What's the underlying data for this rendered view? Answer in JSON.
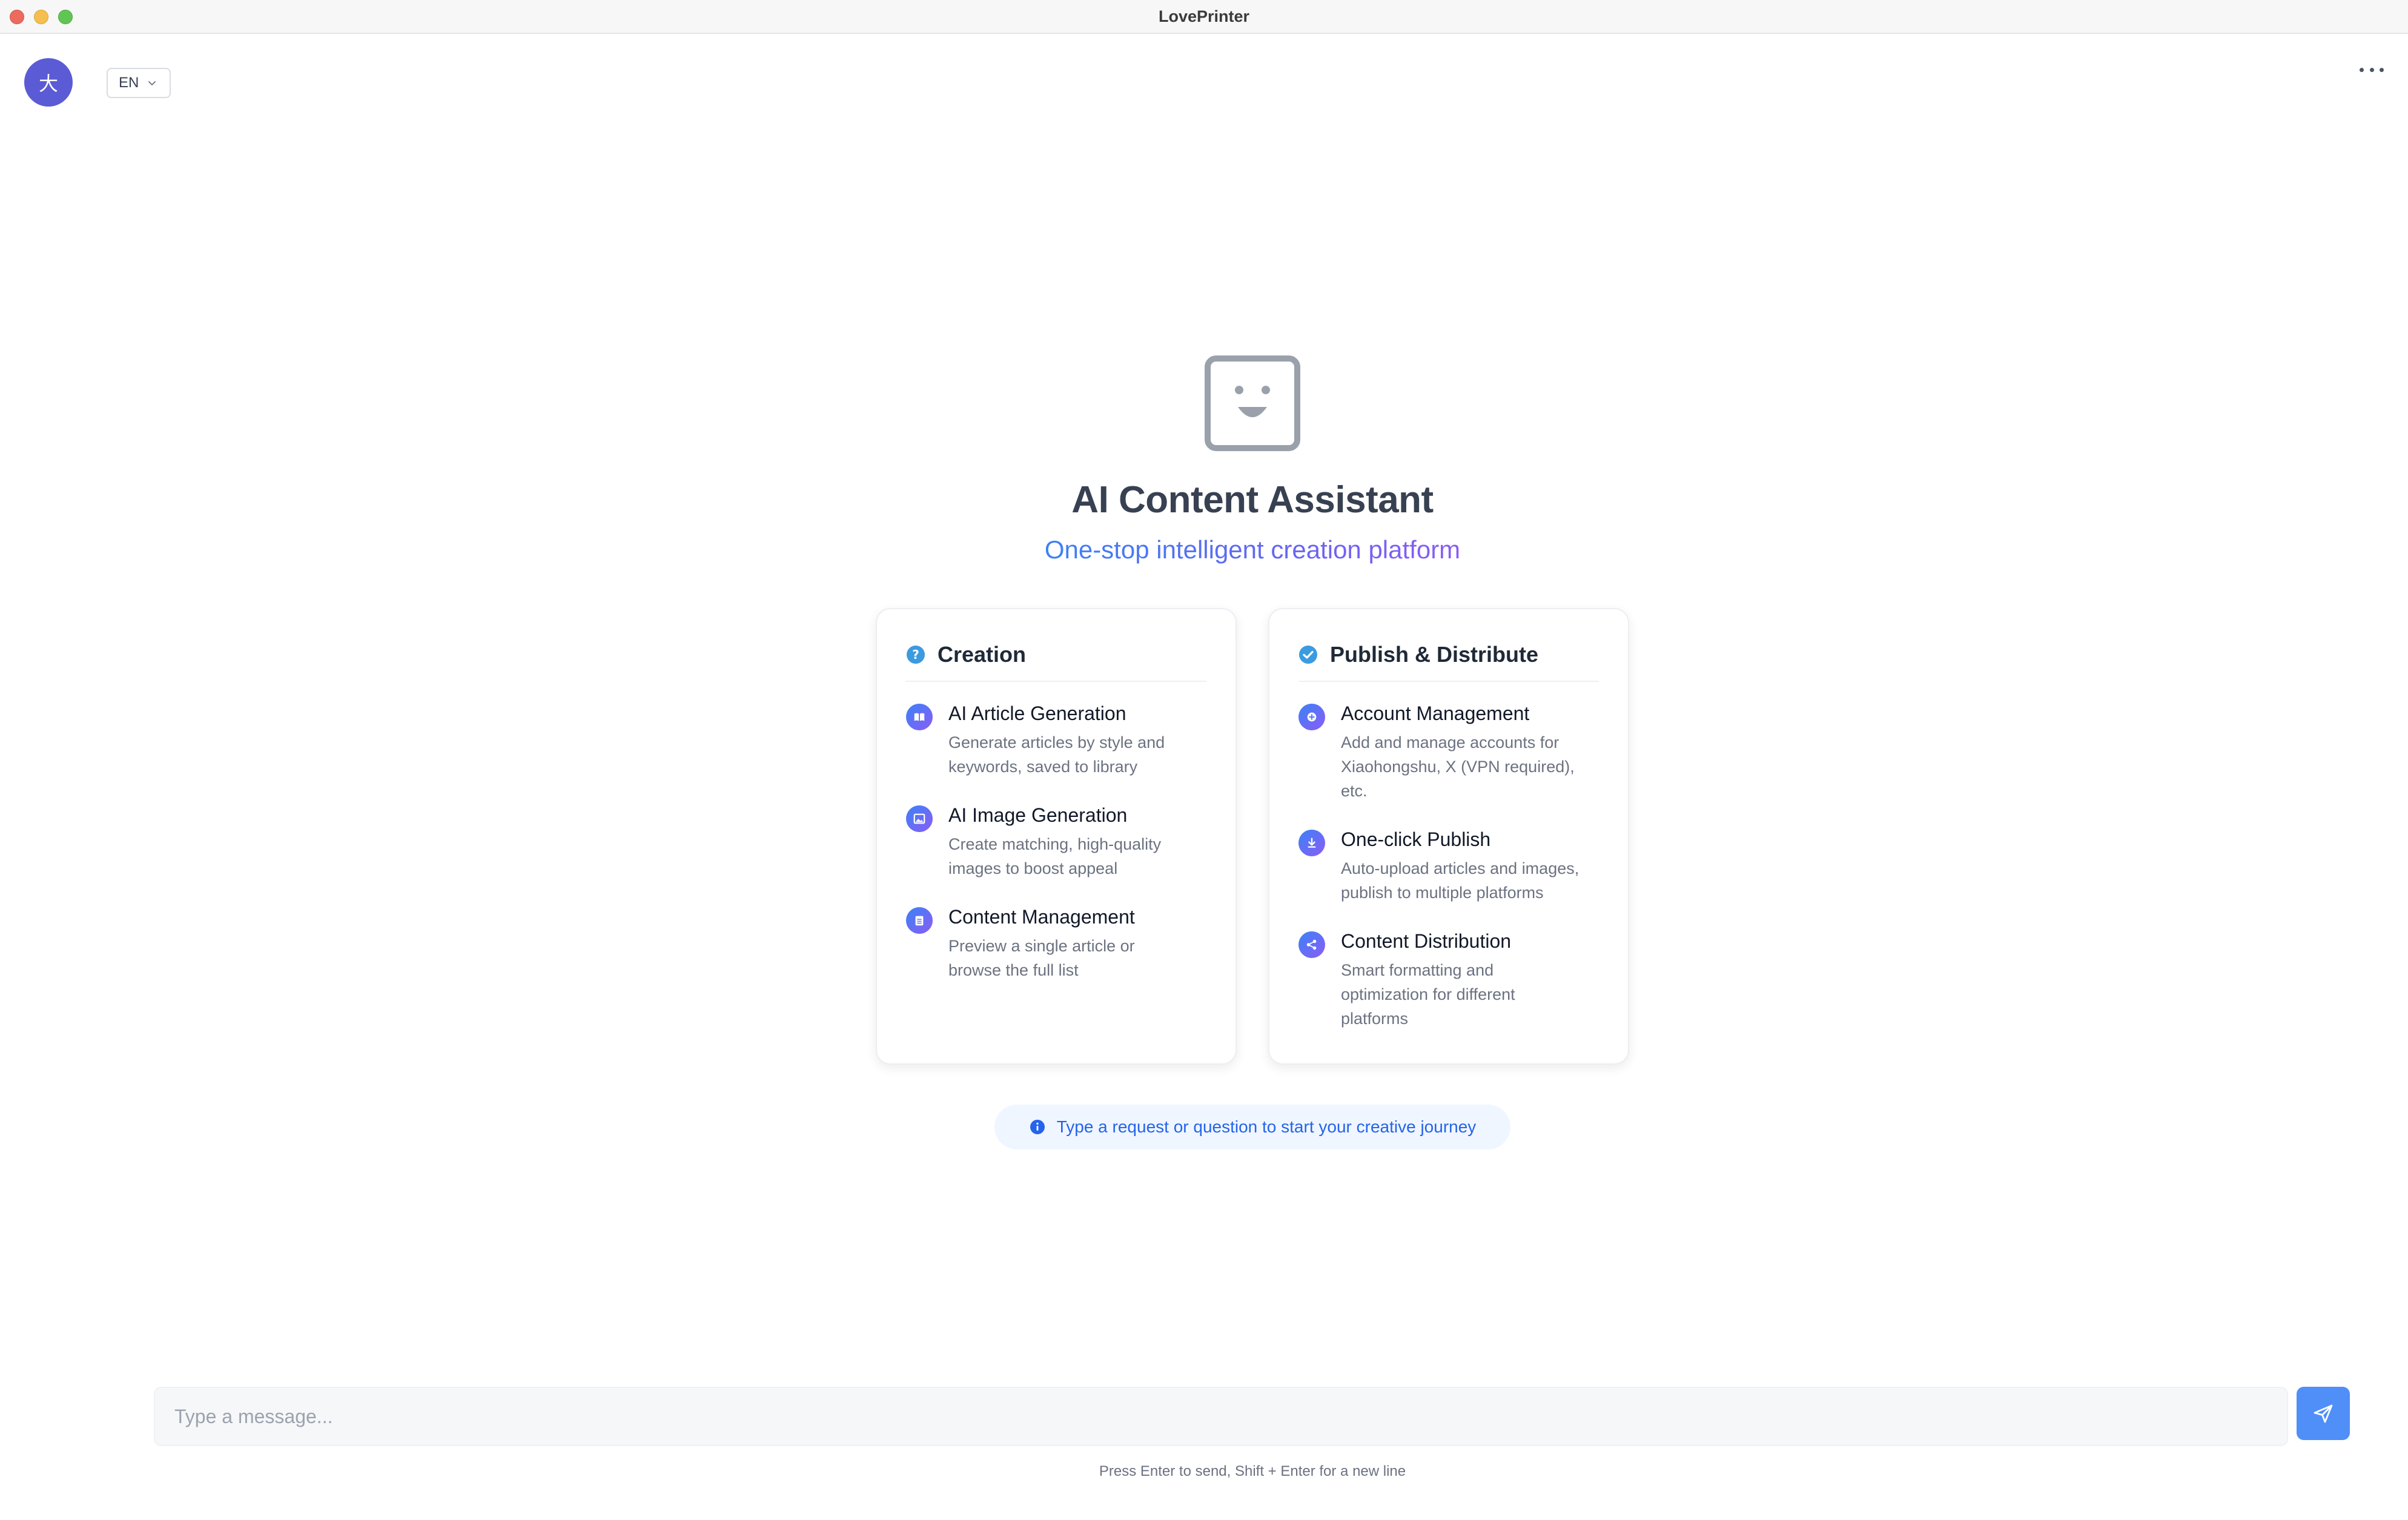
{
  "window": {
    "title": "LovePrinter"
  },
  "header": {
    "avatar_text": "大",
    "language": "EN",
    "more_icon": "ellipsis-icon"
  },
  "hero": {
    "title": "AI Content Assistant",
    "subtitle": "One-stop intelligent creation platform",
    "icon": "robot-face-icon"
  },
  "cards": [
    {
      "title": "Creation",
      "icon": "question-circle-icon",
      "items": [
        {
          "title": "AI Article Generation",
          "desc": [
            "Generate articles by style and",
            "keywords, saved to library"
          ],
          "icon": "book-icon"
        },
        {
          "title": "AI Image Generation",
          "desc": [
            "Create matching, high-quality",
            "images to boost appeal"
          ],
          "icon": "image-icon"
        },
        {
          "title": "Content Management",
          "desc": [
            "Preview a single article or",
            "browse the full list"
          ],
          "icon": "clipboard-icon"
        }
      ]
    },
    {
      "title": "Publish & Distribute",
      "icon": "check-circle-icon",
      "items": [
        {
          "title": "Account Management",
          "desc": [
            "Add and manage accounts for",
            "Xiaohongshu, X (VPN required),",
            "etc."
          ],
          "icon": "plus-circle-icon"
        },
        {
          "title": "One-click Publish",
          "desc": [
            "Auto-upload articles and images,",
            "publish to multiple platforms"
          ],
          "icon": "download-icon"
        },
        {
          "title": "Content Distribution",
          "desc": [
            "Smart formatting and",
            "optimization for different",
            "platforms"
          ],
          "icon": "share-icon"
        }
      ]
    }
  ],
  "hint": {
    "text": "Type a request or question to start your creative journey"
  },
  "composer": {
    "placeholder": "Type a message...",
    "send_hint": "Press Enter to send, Shift + Enter for a new line"
  },
  "colors": {
    "accent": "#4f8ff7",
    "avatar": "#5b5bd6",
    "hint_text": "#2563eb"
  }
}
